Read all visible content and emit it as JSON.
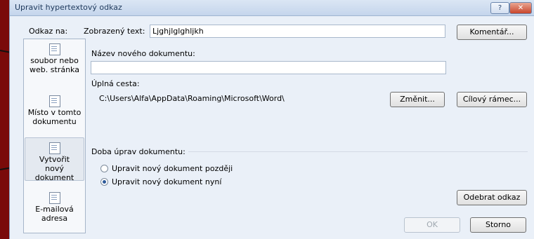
{
  "window": {
    "title": "Upravit hypertextový odkaz",
    "help_label": "?",
    "close_label": "✕"
  },
  "nav": {
    "label": "Odkaz na:",
    "items": [
      {
        "label": "Existující soubor nebo web. stránka",
        "icon": "globe-document-icon"
      },
      {
        "label": "Místo v tomto dokumentu",
        "icon": "document-place-icon"
      },
      {
        "label": "Vytvořit nový dokument",
        "icon": "new-document-icon"
      },
      {
        "label": "E-mailová adresa",
        "icon": "email-icon"
      }
    ],
    "visible_top_label": "soubor nebo web. stránka",
    "active_index": 2
  },
  "display_text": {
    "label": "Zobrazený text:",
    "value": "Ljghjlglghljkh"
  },
  "comment_button": "Komentář...",
  "new_doc_name": {
    "label": "Název nového dokumentu:",
    "value": ""
  },
  "full_path": {
    "label": "Úplná cesta:",
    "value": "C:\\Users\\Alfa\\AppData\\Roaming\\Microsoft\\Word\\"
  },
  "change_button": "Změnit...",
  "target_frame_button": "Cílový rámec...",
  "edit_time": {
    "label": "Doba úprav dokumentu:",
    "options": [
      {
        "label": "Upravit nový dokument později",
        "selected": false
      },
      {
        "label": "Upravit nový dokument nyní",
        "selected": true
      }
    ]
  },
  "remove_link_button": "Odebrat odkaz",
  "ok_button": "OK",
  "cancel_button": "Storno",
  "colors": {
    "background": "#7a0a0a",
    "dialog": "#eaf0f8",
    "arrow": "#1a1a1a"
  }
}
